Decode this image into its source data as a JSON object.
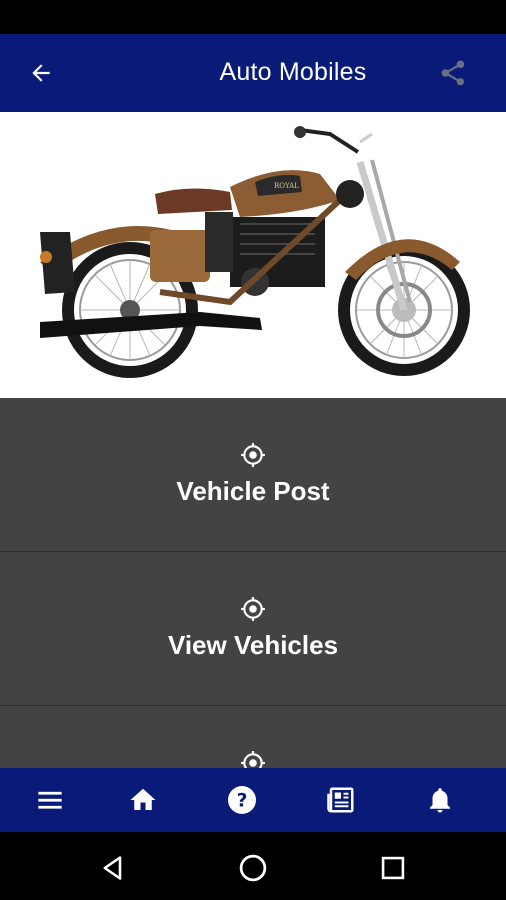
{
  "app_bar": {
    "title": "Auto Mobiles",
    "back_icon": "arrow-left-icon",
    "share_icon": "share-icon",
    "color": "#0a1a78"
  },
  "hero": {
    "image": "motorcycle-photo"
  },
  "menu": {
    "items": [
      {
        "label": "Vehicle Post",
        "icon": "target-icon"
      },
      {
        "label": "View Vehicles",
        "icon": "target-icon"
      },
      {
        "label": "",
        "icon": "target-icon"
      }
    ],
    "background": "#434343"
  },
  "bottom_nav": {
    "items": [
      {
        "icon": "menu-icon"
      },
      {
        "icon": "home-icon"
      },
      {
        "icon": "help-icon"
      },
      {
        "icon": "news-icon"
      },
      {
        "icon": "bell-icon"
      }
    ]
  },
  "system_nav": {
    "items": [
      "back-triangle-icon",
      "home-circle-icon",
      "recents-square-icon"
    ]
  }
}
